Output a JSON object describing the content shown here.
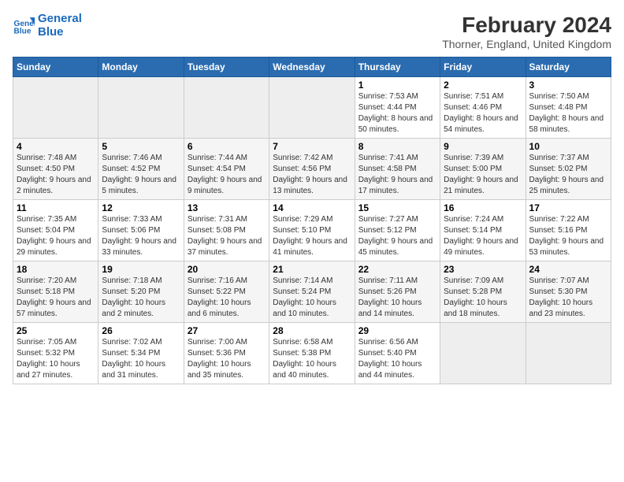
{
  "logo": {
    "line1": "General",
    "line2": "Blue"
  },
  "title": "February 2024",
  "subtitle": "Thorner, England, United Kingdom",
  "days_header": [
    "Sunday",
    "Monday",
    "Tuesday",
    "Wednesday",
    "Thursday",
    "Friday",
    "Saturday"
  ],
  "weeks": [
    [
      {
        "day": "",
        "info": ""
      },
      {
        "day": "",
        "info": ""
      },
      {
        "day": "",
        "info": ""
      },
      {
        "day": "",
        "info": ""
      },
      {
        "day": "1",
        "info": "Sunrise: 7:53 AM\nSunset: 4:44 PM\nDaylight: 8 hours and 50 minutes."
      },
      {
        "day": "2",
        "info": "Sunrise: 7:51 AM\nSunset: 4:46 PM\nDaylight: 8 hours and 54 minutes."
      },
      {
        "day": "3",
        "info": "Sunrise: 7:50 AM\nSunset: 4:48 PM\nDaylight: 8 hours and 58 minutes."
      }
    ],
    [
      {
        "day": "4",
        "info": "Sunrise: 7:48 AM\nSunset: 4:50 PM\nDaylight: 9 hours and 2 minutes."
      },
      {
        "day": "5",
        "info": "Sunrise: 7:46 AM\nSunset: 4:52 PM\nDaylight: 9 hours and 5 minutes."
      },
      {
        "day": "6",
        "info": "Sunrise: 7:44 AM\nSunset: 4:54 PM\nDaylight: 9 hours and 9 minutes."
      },
      {
        "day": "7",
        "info": "Sunrise: 7:42 AM\nSunset: 4:56 PM\nDaylight: 9 hours and 13 minutes."
      },
      {
        "day": "8",
        "info": "Sunrise: 7:41 AM\nSunset: 4:58 PM\nDaylight: 9 hours and 17 minutes."
      },
      {
        "day": "9",
        "info": "Sunrise: 7:39 AM\nSunset: 5:00 PM\nDaylight: 9 hours and 21 minutes."
      },
      {
        "day": "10",
        "info": "Sunrise: 7:37 AM\nSunset: 5:02 PM\nDaylight: 9 hours and 25 minutes."
      }
    ],
    [
      {
        "day": "11",
        "info": "Sunrise: 7:35 AM\nSunset: 5:04 PM\nDaylight: 9 hours and 29 minutes."
      },
      {
        "day": "12",
        "info": "Sunrise: 7:33 AM\nSunset: 5:06 PM\nDaylight: 9 hours and 33 minutes."
      },
      {
        "day": "13",
        "info": "Sunrise: 7:31 AM\nSunset: 5:08 PM\nDaylight: 9 hours and 37 minutes."
      },
      {
        "day": "14",
        "info": "Sunrise: 7:29 AM\nSunset: 5:10 PM\nDaylight: 9 hours and 41 minutes."
      },
      {
        "day": "15",
        "info": "Sunrise: 7:27 AM\nSunset: 5:12 PM\nDaylight: 9 hours and 45 minutes."
      },
      {
        "day": "16",
        "info": "Sunrise: 7:24 AM\nSunset: 5:14 PM\nDaylight: 9 hours and 49 minutes."
      },
      {
        "day": "17",
        "info": "Sunrise: 7:22 AM\nSunset: 5:16 PM\nDaylight: 9 hours and 53 minutes."
      }
    ],
    [
      {
        "day": "18",
        "info": "Sunrise: 7:20 AM\nSunset: 5:18 PM\nDaylight: 9 hours and 57 minutes."
      },
      {
        "day": "19",
        "info": "Sunrise: 7:18 AM\nSunset: 5:20 PM\nDaylight: 10 hours and 2 minutes."
      },
      {
        "day": "20",
        "info": "Sunrise: 7:16 AM\nSunset: 5:22 PM\nDaylight: 10 hours and 6 minutes."
      },
      {
        "day": "21",
        "info": "Sunrise: 7:14 AM\nSunset: 5:24 PM\nDaylight: 10 hours and 10 minutes."
      },
      {
        "day": "22",
        "info": "Sunrise: 7:11 AM\nSunset: 5:26 PM\nDaylight: 10 hours and 14 minutes."
      },
      {
        "day": "23",
        "info": "Sunrise: 7:09 AM\nSunset: 5:28 PM\nDaylight: 10 hours and 18 minutes."
      },
      {
        "day": "24",
        "info": "Sunrise: 7:07 AM\nSunset: 5:30 PM\nDaylight: 10 hours and 23 minutes."
      }
    ],
    [
      {
        "day": "25",
        "info": "Sunrise: 7:05 AM\nSunset: 5:32 PM\nDaylight: 10 hours and 27 minutes."
      },
      {
        "day": "26",
        "info": "Sunrise: 7:02 AM\nSunset: 5:34 PM\nDaylight: 10 hours and 31 minutes."
      },
      {
        "day": "27",
        "info": "Sunrise: 7:00 AM\nSunset: 5:36 PM\nDaylight: 10 hours and 35 minutes."
      },
      {
        "day": "28",
        "info": "Sunrise: 6:58 AM\nSunset: 5:38 PM\nDaylight: 10 hours and 40 minutes."
      },
      {
        "day": "29",
        "info": "Sunrise: 6:56 AM\nSunset: 5:40 PM\nDaylight: 10 hours and 44 minutes."
      },
      {
        "day": "",
        "info": ""
      },
      {
        "day": "",
        "info": ""
      }
    ]
  ]
}
